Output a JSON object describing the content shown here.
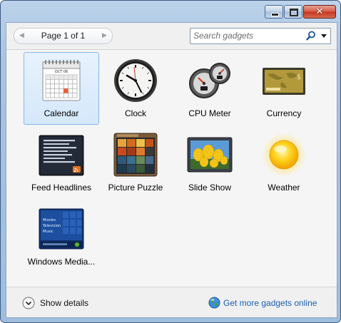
{
  "window": {
    "controls": {
      "minimize_icon": "minimize-icon",
      "maximize_icon": "maximize-icon",
      "close_label": "✕"
    }
  },
  "toolbar": {
    "page_label": "Page 1 of 1",
    "prev_icon": "◀",
    "next_icon": "▶",
    "search_placeholder": "Search gadgets",
    "search_value": ""
  },
  "gadgets": [
    {
      "label": "Calendar",
      "icon": "calendar-icon",
      "selected": true,
      "month": "OCT 06"
    },
    {
      "label": "Clock",
      "icon": "clock-icon",
      "selected": false
    },
    {
      "label": "CPU Meter",
      "icon": "cpu-meter-icon",
      "selected": false
    },
    {
      "label": "Currency",
      "icon": "currency-icon",
      "selected": false
    },
    {
      "label": "Feed Headlines",
      "icon": "feed-headlines-icon",
      "selected": false
    },
    {
      "label": "Picture Puzzle",
      "icon": "picture-puzzle-icon",
      "selected": false
    },
    {
      "label": "Slide Show",
      "icon": "slide-show-icon",
      "selected": false
    },
    {
      "label": "Weather",
      "icon": "weather-icon",
      "selected": false
    },
    {
      "label": "Windows Media...",
      "icon": "windows-media-center-icon",
      "selected": false,
      "menu": [
        "Movies",
        "Television",
        "Music"
      ]
    }
  ],
  "footer": {
    "show_details_label": "Show details",
    "more_online_label": "Get more gadgets online"
  },
  "colors": {
    "accent": "#1b5fb8",
    "selection_border": "#8ab7e6",
    "title_gradient": "#a9c4e2"
  }
}
